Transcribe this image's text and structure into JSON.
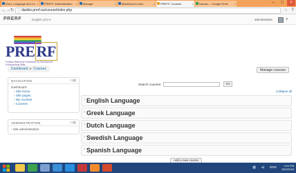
{
  "browser": {
    "tabs": [
      {
        "label": "Elect. Language and Co",
        "active": false
      },
      {
        "label": "PREFF: Administration",
        "active": false
      },
      {
        "label": "Manage",
        "active": false
      },
      {
        "label": "Blackboard Learn",
        "active": false
      },
      {
        "label": "PREFF: Courses",
        "active": true
      },
      {
        "label": "Ioanna — Google Drive",
        "active": false
      }
    ],
    "address": "dastbo.prerf.eu/course/index.php",
    "colors": {
      "tab_strip": "#f3a25a",
      "close_button": "#e05a3a"
    }
  },
  "navbar": {
    "brand": "PRERF",
    "language": "English (en) ▾",
    "user": "administrator"
  },
  "logo": {
    "text_pre": "PRE",
    "text_boxed": "RF",
    "tagline": "Portfolio Reference Framework for Development of Intercultural Skills",
    "bar_colors": [
      "#d23b3b",
      "#f0a030",
      "#f2d43a",
      "#4aa84a",
      "#3a6fc8",
      "#8a4ab0"
    ]
  },
  "breadcrumb": {
    "items": [
      "Dashboard",
      "Courses"
    ],
    "separator": "►"
  },
  "manage_button": "Manage courses",
  "navigation_block": {
    "title": "NAVIGATION",
    "items": [
      {
        "label": "Dashboard",
        "level": "root"
      },
      {
        "label": "Site home",
        "level": "child"
      },
      {
        "label": "Site pages",
        "level": "child"
      },
      {
        "label": "My courses",
        "level": "child"
      },
      {
        "label": "Courses",
        "level": "child"
      }
    ]
  },
  "admin_block": {
    "title": "ADMINISTRATION",
    "items": [
      {
        "label": "Site administration"
      }
    ]
  },
  "search": {
    "label": "Search courses:",
    "value": "",
    "placeholder": "",
    "button": "Go"
  },
  "collapse_all": "Collapse all",
  "categories": [
    "English Language",
    "Greek Language",
    "Dutch Language",
    "Swedish Language",
    "Spanish Language"
  ],
  "add_category_button": "Add a new course",
  "taskbar": {
    "apps": [
      "explorer",
      "chrome",
      "firefox",
      "notepad",
      "skype",
      "acrobat",
      "word",
      "powerpoint"
    ],
    "language": "ENG",
    "time": "1:54 PM",
    "date": "25/2/2016"
  }
}
